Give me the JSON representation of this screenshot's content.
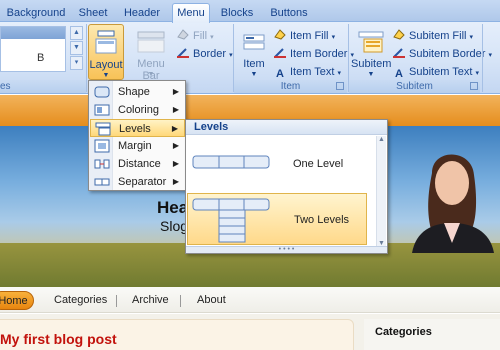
{
  "tabs": [
    "Background",
    "Sheet",
    "Header",
    "Menu",
    "Blocks",
    "Buttons"
  ],
  "active_tab": "Menu",
  "ribbon": {
    "left_group": {
      "field_value": "B",
      "caption": "es"
    },
    "layout_button": {
      "label": "Layout"
    },
    "menu_bar_button": {
      "label": "Menu Bar"
    },
    "fill_button": {
      "label": "Fill"
    },
    "border_button": {
      "label": "Border"
    },
    "item_group": {
      "caption": "Item",
      "item_button": "Item",
      "item_fill": "Item Fill",
      "item_border": "Item Border",
      "item_text": "Item Text"
    },
    "subitem_group": {
      "caption": "Subitem",
      "subitem_button": "Subitem",
      "subitem_fill": "Subitem Fill",
      "subitem_border": "Subitem Border",
      "subitem_text": "Subitem Text"
    }
  },
  "layout_menu": {
    "items": [
      {
        "label": "Shape",
        "icon": "shape-icon"
      },
      {
        "label": "Coloring",
        "icon": "coloring-icon"
      },
      {
        "label": "Levels",
        "icon": "levels-icon"
      },
      {
        "label": "Margin",
        "icon": "margin-icon"
      },
      {
        "label": "Distance",
        "icon": "distance-icon"
      },
      {
        "label": "Separator",
        "icon": "separator-icon"
      }
    ],
    "active_item": "Levels"
  },
  "levels_gallery": {
    "header": "Levels",
    "options": [
      {
        "label": "One Level"
      },
      {
        "label": "Two Levels"
      }
    ],
    "selected": "Two Levels"
  },
  "preview": {
    "site_title": "Hea",
    "site_slogan": "Slog",
    "nav": [
      "Home",
      "Categories",
      "Archive",
      "About"
    ],
    "post_title": "My first blog post",
    "sidebar_title": "Categories"
  },
  "colors": {
    "ribbon_bg": "#d6e4f7",
    "accent_orange": "#e58d1c",
    "post_title": "#c2120c",
    "hover_highlight": "#ffd87a"
  }
}
